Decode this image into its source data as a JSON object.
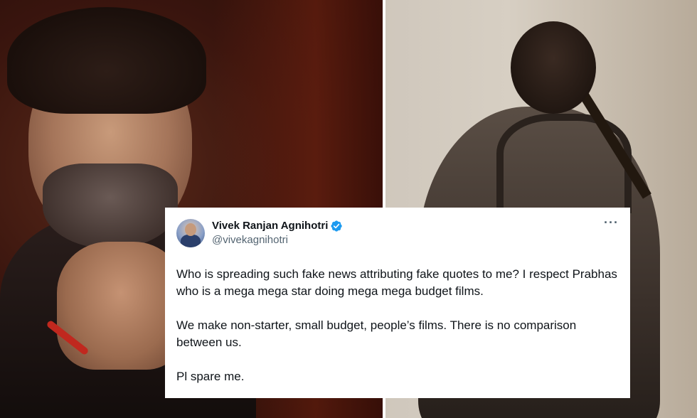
{
  "tweet": {
    "display_name": "Vivek Ranjan Agnihotri",
    "handle": "@vivekagnihotri",
    "verified_icon": "verified-badge-icon",
    "more_icon": "more-options-icon",
    "paragraphs": [
      "Who is spreading such fake news attributing fake quotes to me? I respect Prabhas who is a mega mega star doing mega mega budget films.",
      "We make non-starter, small budget, people’s films. There is no comparison between us.",
      "Pl spare me."
    ],
    "more_label": "···"
  },
  "colors": {
    "text_primary": "#0f1419",
    "text_secondary": "#536471",
    "verified_blue": "#1d9bf0",
    "card_bg": "#ffffff"
  }
}
